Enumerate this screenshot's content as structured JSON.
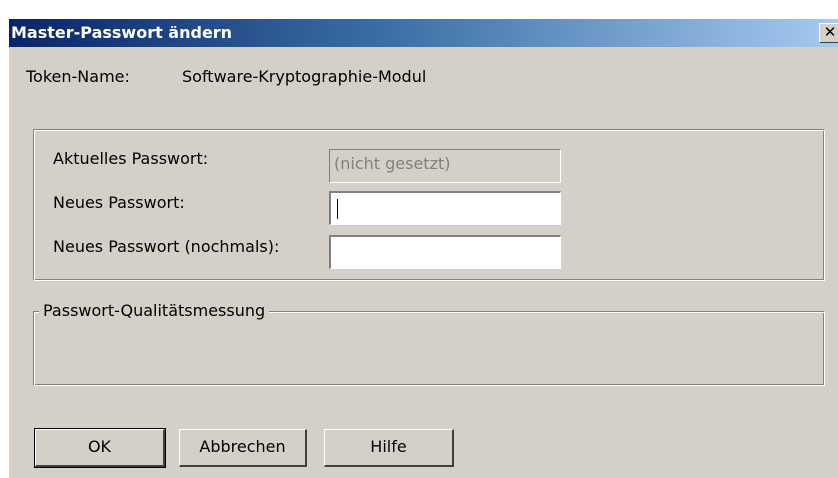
{
  "window": {
    "title": "Master-Passwort ändern",
    "close_glyph": "✕"
  },
  "token": {
    "label": "Token-Name:",
    "value": "Software-Kryptographie-Modul"
  },
  "password_group": {
    "current_label": "Aktuelles Passwort:",
    "current_value": "(nicht gesetzt)",
    "new_label": "Neues Passwort:",
    "new_value": "",
    "confirm_label": "Neues Passwort (nochmals):",
    "confirm_value": ""
  },
  "quality_group": {
    "legend": "Passwort-Qualitätsmessung"
  },
  "buttons": {
    "ok": "OK",
    "cancel": "Abbrechen",
    "help": "Hilfe"
  }
}
